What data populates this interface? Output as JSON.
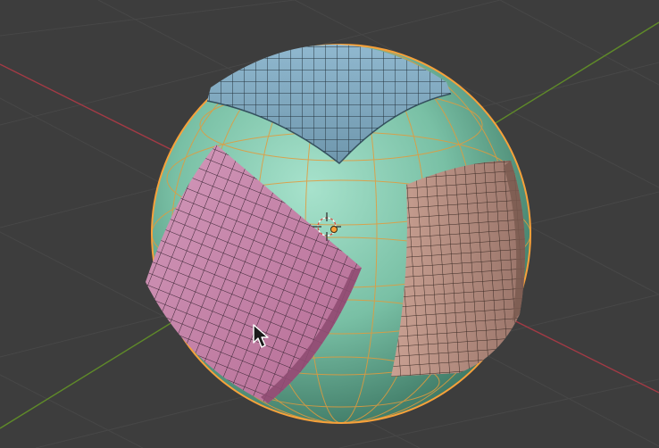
{
  "viewport": {
    "background": "#3d3d3d",
    "grid_color": "#484848",
    "axis_x_color": "#b5404b",
    "axis_y_color": "#6d9a2d"
  },
  "scene": {
    "sphere": {
      "name": "sphere-object",
      "base_color": "#8ed2b8",
      "shade_color": "#4f8f7a",
      "selection_outline_color": "#f7a13a",
      "state": "selected"
    },
    "patches": [
      {
        "name": "top-patch",
        "color": "#7ea6bd"
      },
      {
        "name": "left-patch",
        "color": "#c47ea6"
      },
      {
        "name": "right-patch",
        "color": "#b48c80"
      }
    ],
    "origin_color": "#f7a13a",
    "cursor_3d": "3d-cursor-icon",
    "mouse_cursor": "mouse-pointer-icon"
  }
}
